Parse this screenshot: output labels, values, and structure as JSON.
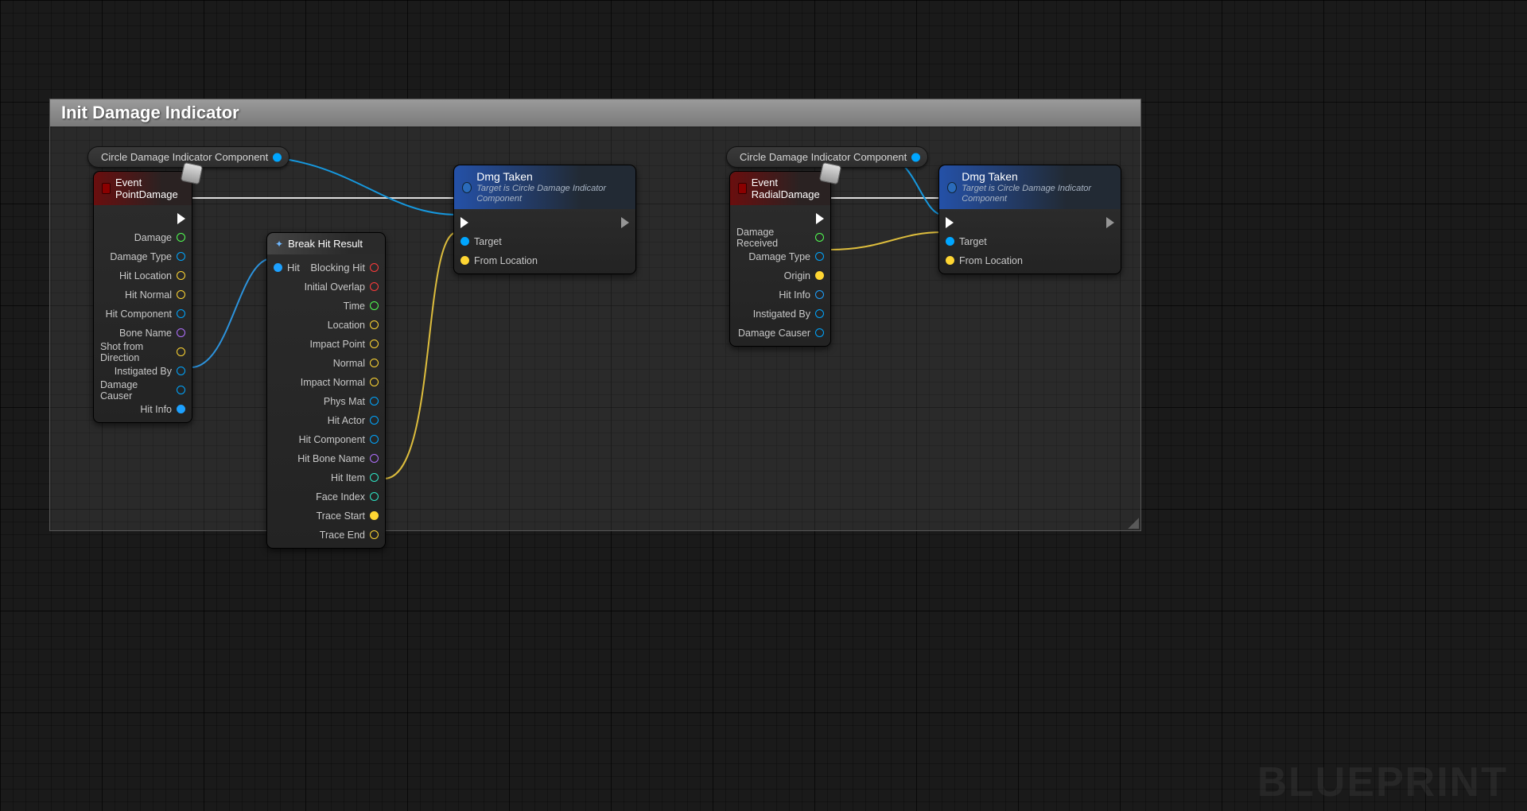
{
  "comment": {
    "title": "Init Damage Indicator"
  },
  "watermark": "BLUEPRINT",
  "pills": {
    "comp_left": "Circle Damage Indicator Component",
    "comp_right": "Circle Damage Indicator Component"
  },
  "point_damage": {
    "title": "Event PointDamage",
    "pins": [
      "Damage",
      "Damage Type",
      "Hit Location",
      "Hit Normal",
      "Hit Component",
      "Bone Name",
      "Shot from Direction",
      "Instigated By",
      "Damage Causer",
      "Hit Info"
    ]
  },
  "radial_damage": {
    "title": "Event RadialDamage",
    "pins": [
      "Damage Received",
      "Damage Type",
      "Origin",
      "Hit Info",
      "Instigated By",
      "Damage Causer"
    ]
  },
  "break_hit": {
    "title": "Break Hit Result",
    "in": "Hit",
    "outs": [
      "Blocking Hit",
      "Initial Overlap",
      "Time",
      "Location",
      "Impact Point",
      "Normal",
      "Impact Normal",
      "Phys Mat",
      "Hit Actor",
      "Hit Component",
      "Hit Bone Name",
      "Hit Item",
      "Face Index",
      "Trace Start",
      "Trace End"
    ]
  },
  "dmg_taken": {
    "title": "Dmg Taken",
    "subtitle": "Target is Circle Damage Indicator Component",
    "pins": {
      "target": "Target",
      "from": "From Location"
    }
  }
}
